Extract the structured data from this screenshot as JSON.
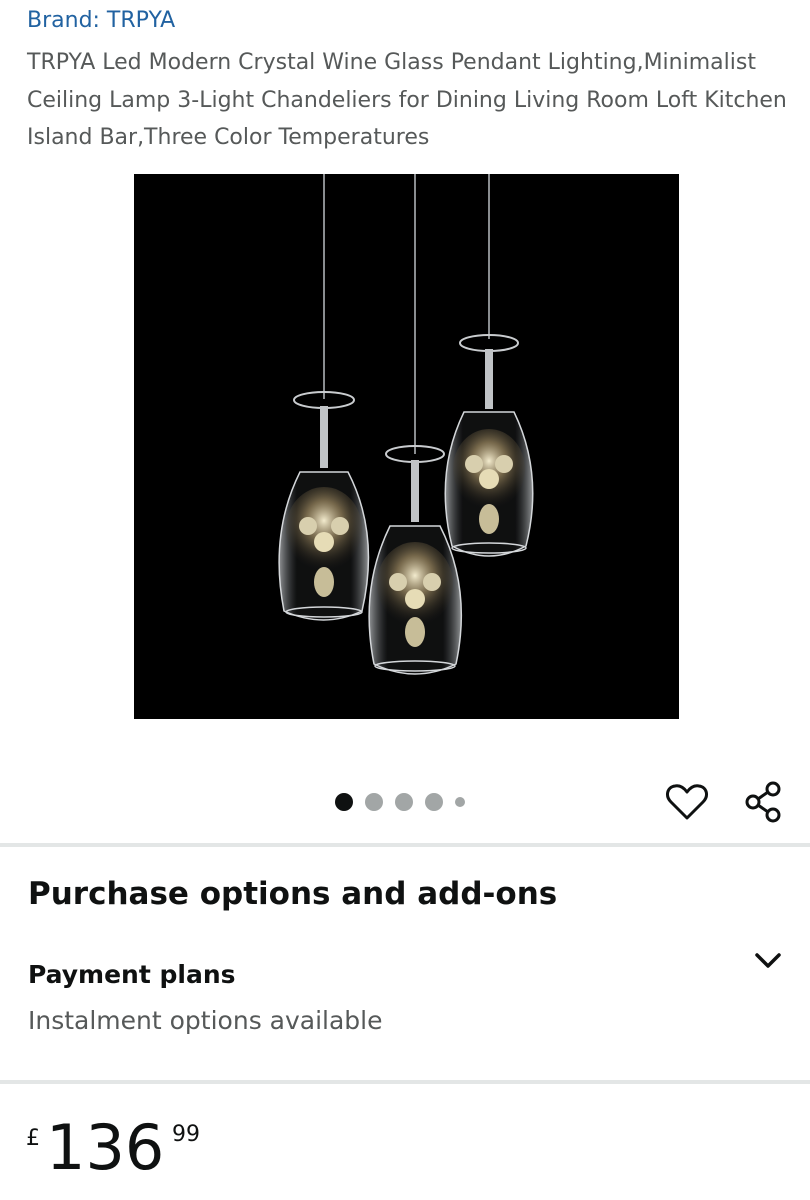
{
  "brand": {
    "label": "Brand: TRPYA"
  },
  "product": {
    "title": "TRPYA Led Modern Crystal Wine Glass Pendant Lighting,Minimalist Ceiling Lamp 3-Light Chandeliers for Dining Living Room Loft Kitchen Island Bar,Three Color Temperatures"
  },
  "gallery": {
    "dot_count": 5,
    "active_index": 0
  },
  "icons": {
    "favorite": "heart-icon",
    "share": "share-icon",
    "expand": "chevron-down-icon"
  },
  "purchase": {
    "heading": "Purchase options and add-ons",
    "payment_label": "Payment plans",
    "payment_sub": "Instalment options available"
  },
  "price": {
    "symbol": "£",
    "whole": "136",
    "fraction": "99"
  },
  "colors": {
    "brand_link": "#2162a1",
    "divider": "#e3e6e6",
    "muted_text": "#565959"
  }
}
